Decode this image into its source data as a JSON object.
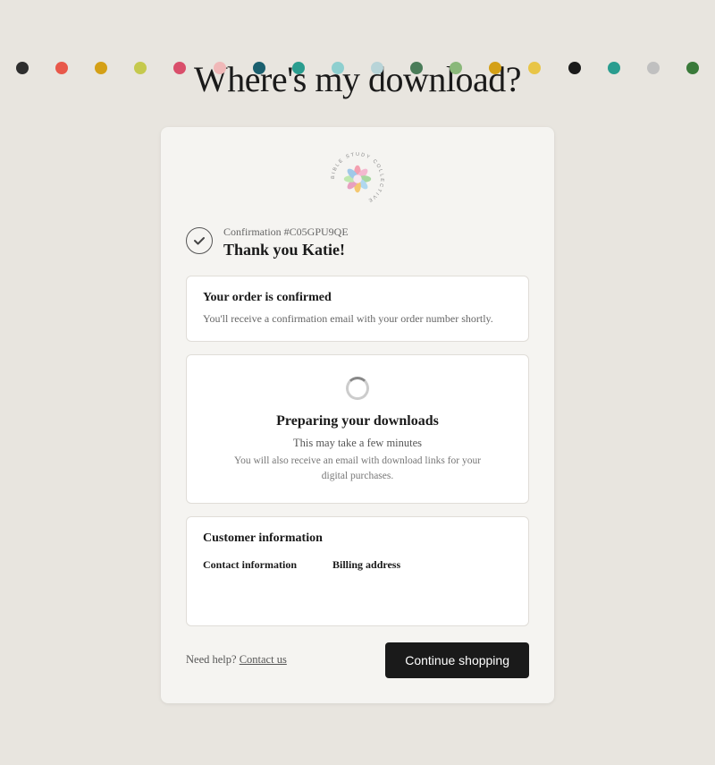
{
  "dots": [
    {
      "color": "#2e2e2e"
    },
    {
      "color": "#e8584a"
    },
    {
      "color": "#d4a017"
    },
    {
      "color": "#c5c94e"
    },
    {
      "color": "#d94f6b"
    },
    {
      "color": "#f0b8b8"
    },
    {
      "color": "#1a5f6e"
    },
    {
      "color": "#2a9d8f"
    },
    {
      "color": "#8ecfcf"
    },
    {
      "color": "#b8d4d8"
    },
    {
      "color": "#4a7c59"
    },
    {
      "color": "#8ab87a"
    },
    {
      "color": "#d4a017"
    },
    {
      "color": "#e8c547"
    },
    {
      "color": "#1a1a1a"
    },
    {
      "color": "#2a9d8f"
    },
    {
      "color": "#c0c0c0"
    },
    {
      "color": "#3a7a3a"
    }
  ],
  "page": {
    "title": "Where's my download?"
  },
  "logo": {
    "alt": "Bible Study Collective"
  },
  "confirmation": {
    "number_label": "Confirmation #C05GPU9QE",
    "thank_you": "Thank you Katie!"
  },
  "order_confirmed": {
    "title": "Your order is confirmed",
    "subtitle": "You'll receive a confirmation email with your order number shortly."
  },
  "downloads": {
    "title": "Preparing your downloads",
    "subtitle": "This may take a few minutes",
    "note": "You will also receive an email with download links for your digital purchases."
  },
  "customer_info": {
    "section_title": "Customer information",
    "contact_label": "Contact information",
    "billing_label": "Billing address",
    "contact_value": "",
    "billing_value": ""
  },
  "footer": {
    "need_help": "Need help?",
    "contact_text": "Contact us",
    "continue_btn": "Continue shopping"
  }
}
